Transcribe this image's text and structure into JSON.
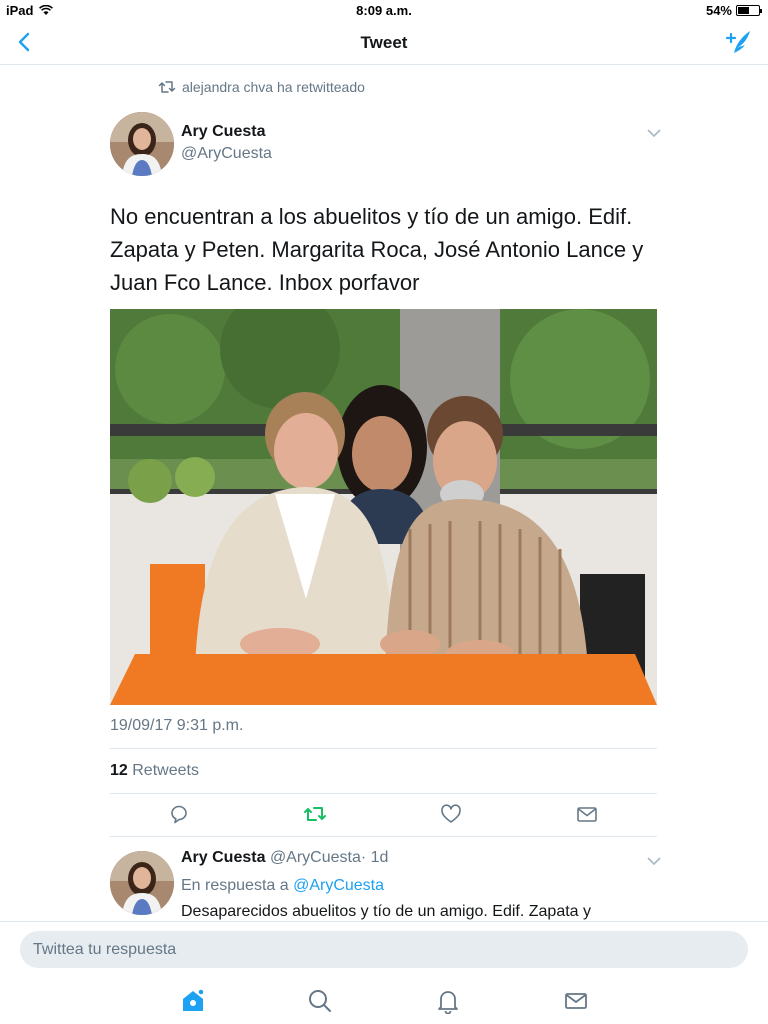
{
  "status_bar": {
    "device": "iPad",
    "time": "8:09 a.m.",
    "battery": "54%"
  },
  "nav": {
    "title": "Tweet"
  },
  "retweet_context": {
    "text": "alejandra chva ha retwitteado"
  },
  "tweet": {
    "author_name": "Ary Cuesta",
    "author_handle": "@AryCuesta",
    "text": "No encuentran a los abuelitos y tío de un amigo. Edif. Zapata y Peten. Margarita Roca, José Antonio Lance y Juan Fco Lance. Inbox porfavor",
    "timestamp": "19/09/17 9:31 p.m.",
    "retweet_count": "12",
    "retweet_label": "Retweets"
  },
  "reply": {
    "author_name": "Ary Cuesta",
    "author_handle": "@AryCuesta",
    "age": "· 1d",
    "reply_prefix": "En respuesta a",
    "reply_to": "@AryCuesta",
    "text": "Desaparecidos abuelitos y tío de un amigo. Edif. Zapata y"
  },
  "composer": {
    "placeholder": "Twittea tu respuesta"
  },
  "tabs": [
    "home-icon",
    "search-icon",
    "notifications-icon",
    "messages-icon"
  ],
  "colors": {
    "accent": "#1da1f2",
    "retweet_green": "#17bf63",
    "muted": "#657786"
  }
}
